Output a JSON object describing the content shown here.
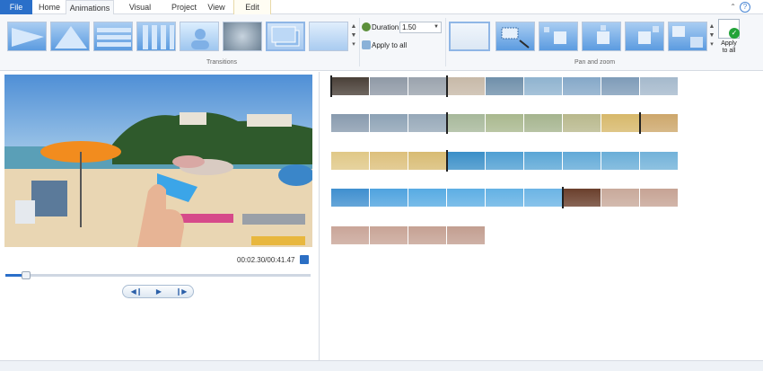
{
  "menu": {
    "file": "File",
    "tabs": [
      {
        "label": "Home"
      },
      {
        "label": "Animations"
      },
      {
        "label": "Visual Effects"
      },
      {
        "label": "Project"
      },
      {
        "label": "View"
      },
      {
        "label": "Edit"
      }
    ],
    "active_tab": "Animations"
  },
  "ribbon": {
    "transitions_label": "Transitions",
    "pan_zoom_label": "Pan and zoom",
    "duration_label": "Duration:",
    "duration_value": "1.50",
    "apply_to_all": "Apply to all",
    "apply_to_all_big": "Apply to all"
  },
  "player": {
    "timecode": "00:02.30/00:41.47",
    "seek_progress": 0.055
  },
  "colors": {
    "accent": "#2a6fc9",
    "ribbon_bg": "#f5f7fa"
  },
  "icons": {
    "help": "help-icon",
    "fullscreen": "fullscreen-icon",
    "prev_frame": "previous-frame-icon",
    "play": "play-icon",
    "next_frame": "next-frame-icon"
  }
}
